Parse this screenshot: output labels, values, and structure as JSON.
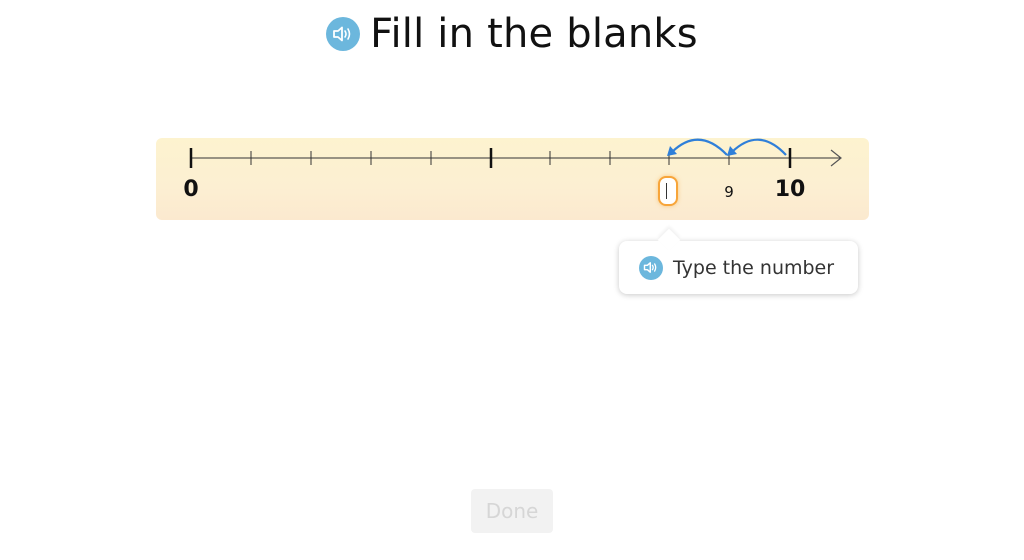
{
  "title": "Fill in the blanks",
  "number_line": {
    "start_label": "0",
    "end_label": "10",
    "given_label": "9",
    "answer_value": ""
  },
  "hint": {
    "text": "Type the number"
  },
  "done_button": {
    "label": "Done",
    "enabled": false
  },
  "icons": {
    "title_audio": "speaker-icon",
    "hint_audio": "speaker-icon",
    "jump_arrows": "curved-arrow-icon"
  },
  "colors": {
    "audio_icon": "#6cb7dd",
    "band": "#fdf3cf",
    "input_border": "#f7a53a",
    "jump_arrow": "#2f7fd9",
    "done_text": "#d6d6d6"
  }
}
